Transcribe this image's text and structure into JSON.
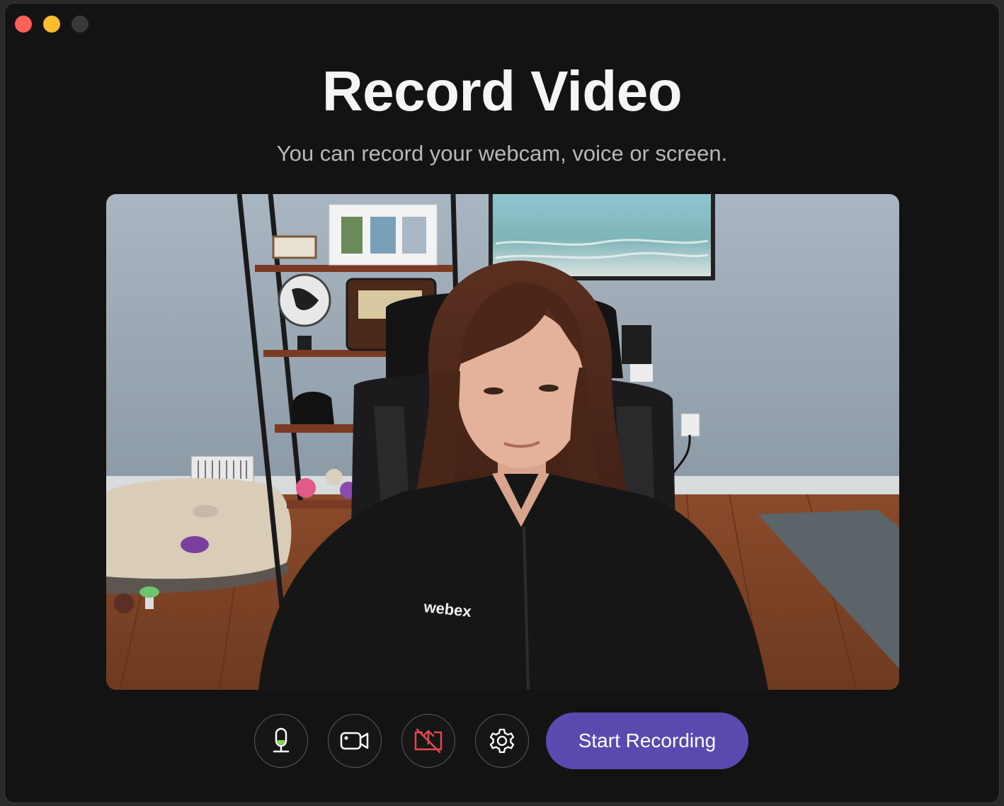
{
  "window": {
    "controls": [
      "close",
      "minimize",
      "maximize"
    ]
  },
  "header": {
    "title": "Record Video",
    "subtitle": "You can record your webcam, voice or screen."
  },
  "preview": {
    "type": "webcam-feed"
  },
  "toolbar": {
    "buttons": [
      {
        "name": "microphone",
        "icon": "microphone-icon",
        "state": "on"
      },
      {
        "name": "camera",
        "icon": "video-camera-icon",
        "state": "on"
      },
      {
        "name": "screen-share",
        "icon": "screen-share-off-icon",
        "state": "off"
      },
      {
        "name": "settings",
        "icon": "gear-icon"
      }
    ],
    "start_label": "Start Recording"
  },
  "colors": {
    "background": "#131313",
    "accent": "#5a4ab0",
    "mic_level": "#7ed957",
    "screen_off": "#e5484d",
    "traffic_close": "#fe5f57",
    "traffic_min": "#febc2e"
  }
}
